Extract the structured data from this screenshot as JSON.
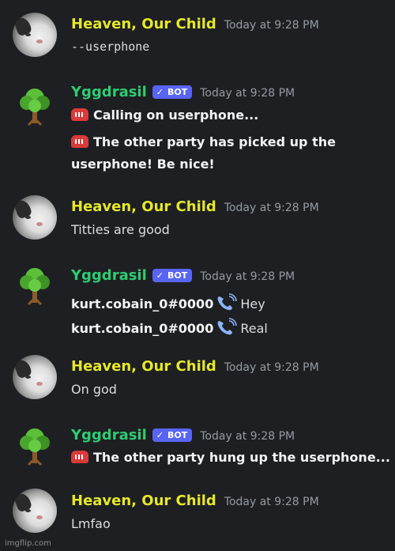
{
  "messages": [
    {
      "author": "Heaven, Our Child",
      "timestamp": "Today at 9:28 PM",
      "lines": [
        "--userphone"
      ]
    },
    {
      "author": "Yggdrasil",
      "badge": "BOT",
      "timestamp": "Today at 9:28 PM",
      "lines": [
        "Calling on userphone...",
        "The other party has picked up the",
        "userphone! Be nice!"
      ]
    },
    {
      "author": "Heaven, Our Child",
      "timestamp": "Today at 9:28 PM",
      "lines": [
        "Titties are good"
      ]
    },
    {
      "author": "Yggdrasil",
      "badge": "BOT",
      "timestamp": "Today at 9:28 PM",
      "lines": [
        {
          "sender": "kurt.cobain_0#0000",
          "text": "Hey"
        },
        {
          "sender": "kurt.cobain_0#0000",
          "text": "Real"
        }
      ]
    },
    {
      "author": "Heaven, Our Child",
      "timestamp": "Today at 9:28 PM",
      "lines": [
        "On god"
      ]
    },
    {
      "author": "Yggdrasil",
      "badge": "BOT",
      "timestamp": "Today at 9:28 PM",
      "lines": [
        "The other party hung up the userphone..."
      ]
    },
    {
      "author": "Heaven, Our Child",
      "timestamp": "Today at 9:28 PM",
      "lines": [
        "Lmfao"
      ]
    }
  ],
  "icons": {
    "telephone": "telephone-icon",
    "handset": "telephone-receiver-icon",
    "bot_check": "checkmark-icon"
  },
  "colors": {
    "background": "#1e1f22",
    "heaven_name": "#e5e82a",
    "yggdrasil_name": "#2ecc71",
    "bot_badge": "#5865f2",
    "timestamp": "#949ba4"
  },
  "watermark": "imgflip.com"
}
